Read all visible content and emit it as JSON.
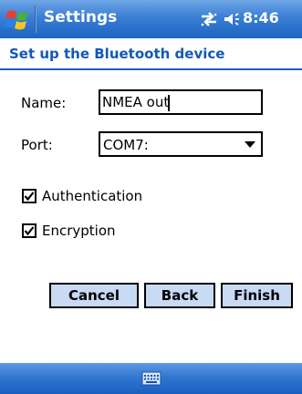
{
  "titlebar": {
    "title": "Settings",
    "time": "8:46",
    "start_icon": "windows-flag-icon",
    "connectivity_icon": "connectivity-icon",
    "volume_icon": "speaker-volume-icon"
  },
  "header": {
    "title": "Set up the Bluetooth device"
  },
  "form": {
    "name_label": "Name:",
    "name_value": "NMEA out",
    "port_label": "Port:",
    "port_value": "COM7:",
    "authentication_label": "Authentication",
    "authentication_checked": true,
    "encryption_label": "Encryption",
    "encryption_checked": true
  },
  "buttons": {
    "cancel": "Cancel",
    "back": "Back",
    "finish": "Finish"
  },
  "menubar": {
    "input_icon": "keyboard-icon"
  },
  "colors": {
    "titlebar_blue": "#2a70cc",
    "header_text": "#1458b8",
    "button_fill": "#c8daf4"
  }
}
